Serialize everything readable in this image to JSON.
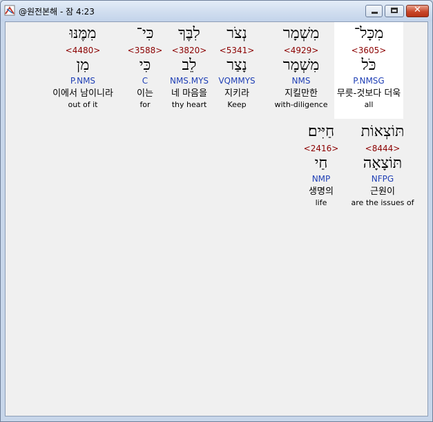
{
  "window": {
    "title": "@원전본해 - 잠 4:23",
    "icon": "app-logo-icon",
    "controls": {
      "minimize": "minimize-icon",
      "maximize": "maximize-icon",
      "close": "✕"
    }
  },
  "rows": [
    {
      "words": [
        {
          "hebrew": "מִכָּל־",
          "strong": "<3605>",
          "lemma": "כֹּל",
          "morph": "P.NMSG",
          "korean": "무릇-것보다 더욱",
          "english": "all",
          "selected": true
        },
        {
          "hebrew": "מִשְׁמָר",
          "strong": "<4929>",
          "lemma": "מִשְׁמָר",
          "morph": "NMS",
          "korean": "지킬만한",
          "english": "with-diligence"
        },
        {
          "hebrew": "נְצֹר",
          "strong": "<5341>",
          "lemma": "נָצַר",
          "morph": "VQMMYS",
          "korean": "지키라",
          "english": "Keep"
        },
        {
          "hebrew": "לִבֶּךָ",
          "strong": "<3820>",
          "lemma": "לֵב",
          "morph": "NMS.MYS",
          "korean": "네 마음을",
          "english": "thy heart"
        },
        {
          "hebrew": "כִּי־",
          "strong": "<3588>",
          "lemma": "כִּי",
          "morph": "C",
          "korean": "이는",
          "english": "for"
        },
        {
          "hebrew": "מִמֶּנּוּ",
          "strong": "<4480>",
          "lemma": "מִן",
          "morph": "P.NMS",
          "korean": "이에서 남이니라",
          "english": "out of it"
        }
      ]
    },
    {
      "words": [
        {
          "hebrew": "תּוֹצְאוֹת",
          "strong": "<8444>",
          "lemma": "תּוֹצָאָה",
          "morph": "NFPG",
          "korean": "근원이",
          "english": "are the issues of"
        },
        {
          "hebrew": "חַיִּים׃",
          "strong": "<2416>",
          "lemma": "חַי",
          "morph": "NMP",
          "korean": "생명의",
          "english": "life"
        }
      ]
    }
  ]
}
